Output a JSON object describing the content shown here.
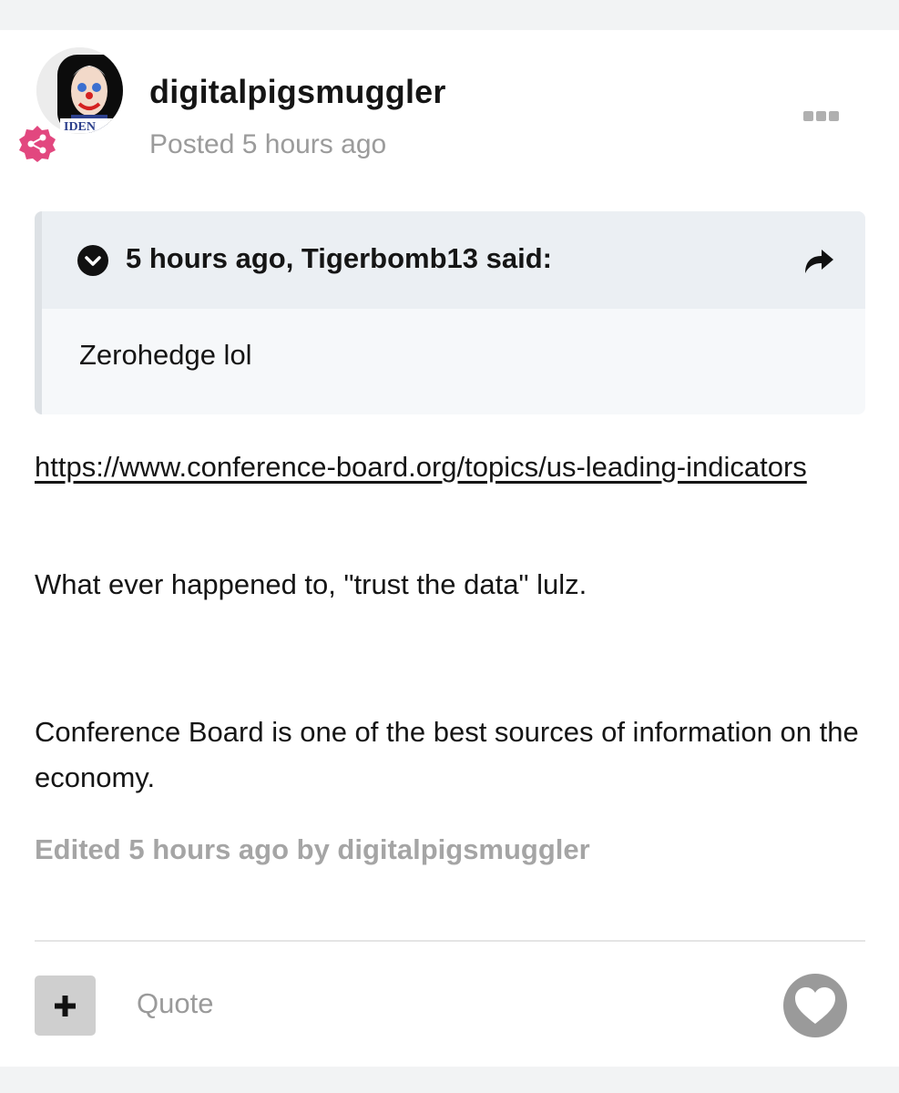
{
  "post": {
    "username": "digitalpigsmuggler",
    "posted": "Posted 5 hours ago",
    "quote": {
      "citation": "5 hours ago, Tigerbomb13 said:",
      "text": "Zerohedge lol"
    },
    "link": "https://www.conference-board.org/topics/us-leading-indicators",
    "paragraph_1": "What ever happened to, \"trust the data\" lulz.",
    "paragraph_2": "Conference Board is one of the best sources of information on the economy.",
    "edited": "Edited 5 hours ago by digitalpigsmuggler",
    "avatar_text": "IDEN"
  },
  "footer": {
    "quote_label": "Quote"
  },
  "icons": {
    "more": "more-options-icon",
    "share_badge": "share-icon",
    "toggle": "chevron-down-circle-icon",
    "quote_share": "forward-arrow-icon",
    "plus": "plus-icon",
    "like": "heart-icon"
  },
  "colors": {
    "badge": "#e2477f",
    "muted_text": "#9b9b9b",
    "quote_header_bg": "#ebeff3",
    "quote_body_bg": "#f6f8fa",
    "like_bg": "#9a9a9a"
  }
}
